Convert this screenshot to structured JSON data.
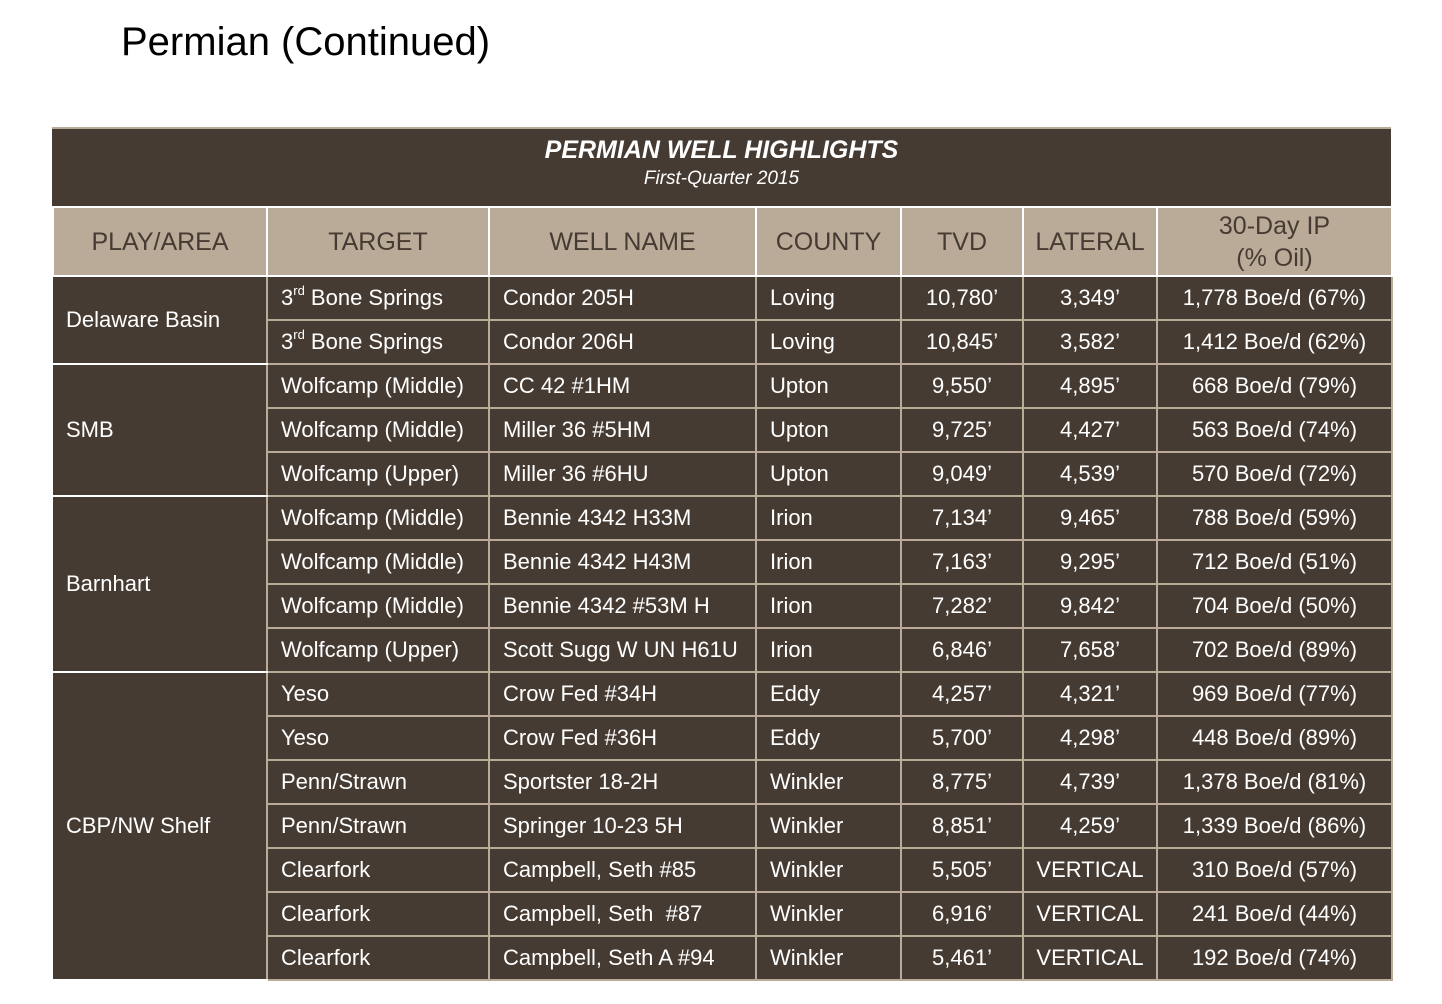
{
  "page_title": "Permian (Continued)",
  "table": {
    "title": "PERMIAN WELL HIGHLIGHTS",
    "subtitle": "First-Quarter 2015",
    "headers": {
      "play": "PLAY/AREA",
      "target": "TARGET",
      "well": "WELL NAME",
      "county": "COUNTY",
      "tvd": "TVD",
      "lateral": "LATERAL",
      "ip_line1": "30-Day IP",
      "ip_line2": "(% Oil)"
    },
    "groups": [
      {
        "play": "Delaware Basin",
        "rows": [
          {
            "target_prefix": "3",
            "target_sup": "rd",
            "target": " Bone Springs",
            "well": "Condor 205H",
            "county": "Loving",
            "tvd": "10,780’",
            "lateral": "3,349’",
            "ip": "1,778 Boe/d (67%)"
          },
          {
            "target_prefix": "3",
            "target_sup": "rd",
            "target": " Bone Springs",
            "well": "Condor 206H",
            "county": "Loving",
            "tvd": "10,845’",
            "lateral": "3,582’",
            "ip": "1,412 Boe/d (62%)"
          }
        ]
      },
      {
        "play": "SMB",
        "rows": [
          {
            "target": "Wolfcamp (Middle)",
            "well": "CC 42 #1HM",
            "county": "Upton",
            "tvd": "9,550’",
            "lateral": "4,895’",
            "ip": "668 Boe/d (79%)"
          },
          {
            "target": "Wolfcamp (Middle)",
            "well": "Miller 36 #5HM",
            "county": "Upton",
            "tvd": "9,725’",
            "lateral": "4,427’",
            "ip": "563 Boe/d (74%)"
          },
          {
            "target": "Wolfcamp (Upper)",
            "well": "Miller 36 #6HU",
            "county": "Upton",
            "tvd": "9,049’",
            "lateral": "4,539’",
            "ip": "570 Boe/d (72%)"
          }
        ]
      },
      {
        "play": "Barnhart",
        "rows": [
          {
            "target": "Wolfcamp (Middle)",
            "well": "Bennie 4342 H33M",
            "county": "Irion",
            "tvd": "7,134’",
            "lateral": "9,465’",
            "ip": "788 Boe/d (59%)"
          },
          {
            "target": "Wolfcamp (Middle)",
            "well": "Bennie 4342 H43M",
            "county": "Irion",
            "tvd": "7,163’",
            "lateral": "9,295’",
            "ip": "712 Boe/d (51%)"
          },
          {
            "target": "Wolfcamp (Middle)",
            "well": "Bennie 4342 #53M H",
            "county": "Irion",
            "tvd": "7,282’",
            "lateral": "9,842’",
            "ip": "704 Boe/d (50%)"
          },
          {
            "target": "Wolfcamp (Upper)",
            "well": "Scott Sugg W UN H61U",
            "county": "Irion",
            "tvd": "6,846’",
            "lateral": "7,658’",
            "ip": "702 Boe/d (89%)"
          }
        ]
      },
      {
        "play": "CBP/NW Shelf",
        "rows": [
          {
            "target": "Yeso",
            "well": "Crow Fed #34H",
            "county": "Eddy",
            "tvd": "4,257’",
            "lateral": "4,321’",
            "ip": "969 Boe/d (77%)"
          },
          {
            "target": "Yeso",
            "well": "Crow Fed #36H",
            "county": "Eddy",
            "tvd": "5,700’",
            "lateral": "4,298’",
            "ip": "448 Boe/d (89%)"
          },
          {
            "target": "Penn/Strawn",
            "well": "Sportster 18-2H",
            "county": "Winkler",
            "tvd": "8,775’",
            "lateral": "4,739’",
            "ip": "1,378 Boe/d (81%)"
          },
          {
            "target": "Penn/Strawn",
            "well": "Springer 10-23 5H",
            "county": "Winkler",
            "tvd": "8,851’",
            "lateral": "4,259’",
            "ip": "1,339 Boe/d (86%)"
          },
          {
            "target": "Clearfork",
            "well": "Campbell, Seth #85",
            "county": "Winkler",
            "tvd": "5,505’",
            "lateral": "VERTICAL",
            "ip": "310 Boe/d (57%)"
          },
          {
            "target": "Clearfork",
            "well": "Campbell, Seth  #87",
            "county": "Winkler",
            "tvd": "6,916’",
            "lateral": "VERTICAL",
            "ip": "241 Boe/d (44%)"
          },
          {
            "target": "Clearfork",
            "well": "Campbell, Seth A #94",
            "county": "Winkler",
            "tvd": "5,461’",
            "lateral": "VERTICAL",
            "ip": "192 Boe/d (74%)"
          }
        ]
      }
    ]
  },
  "colors": {
    "dark": "#463b33",
    "tan": "#b9ab97",
    "white": "#ffffff"
  }
}
